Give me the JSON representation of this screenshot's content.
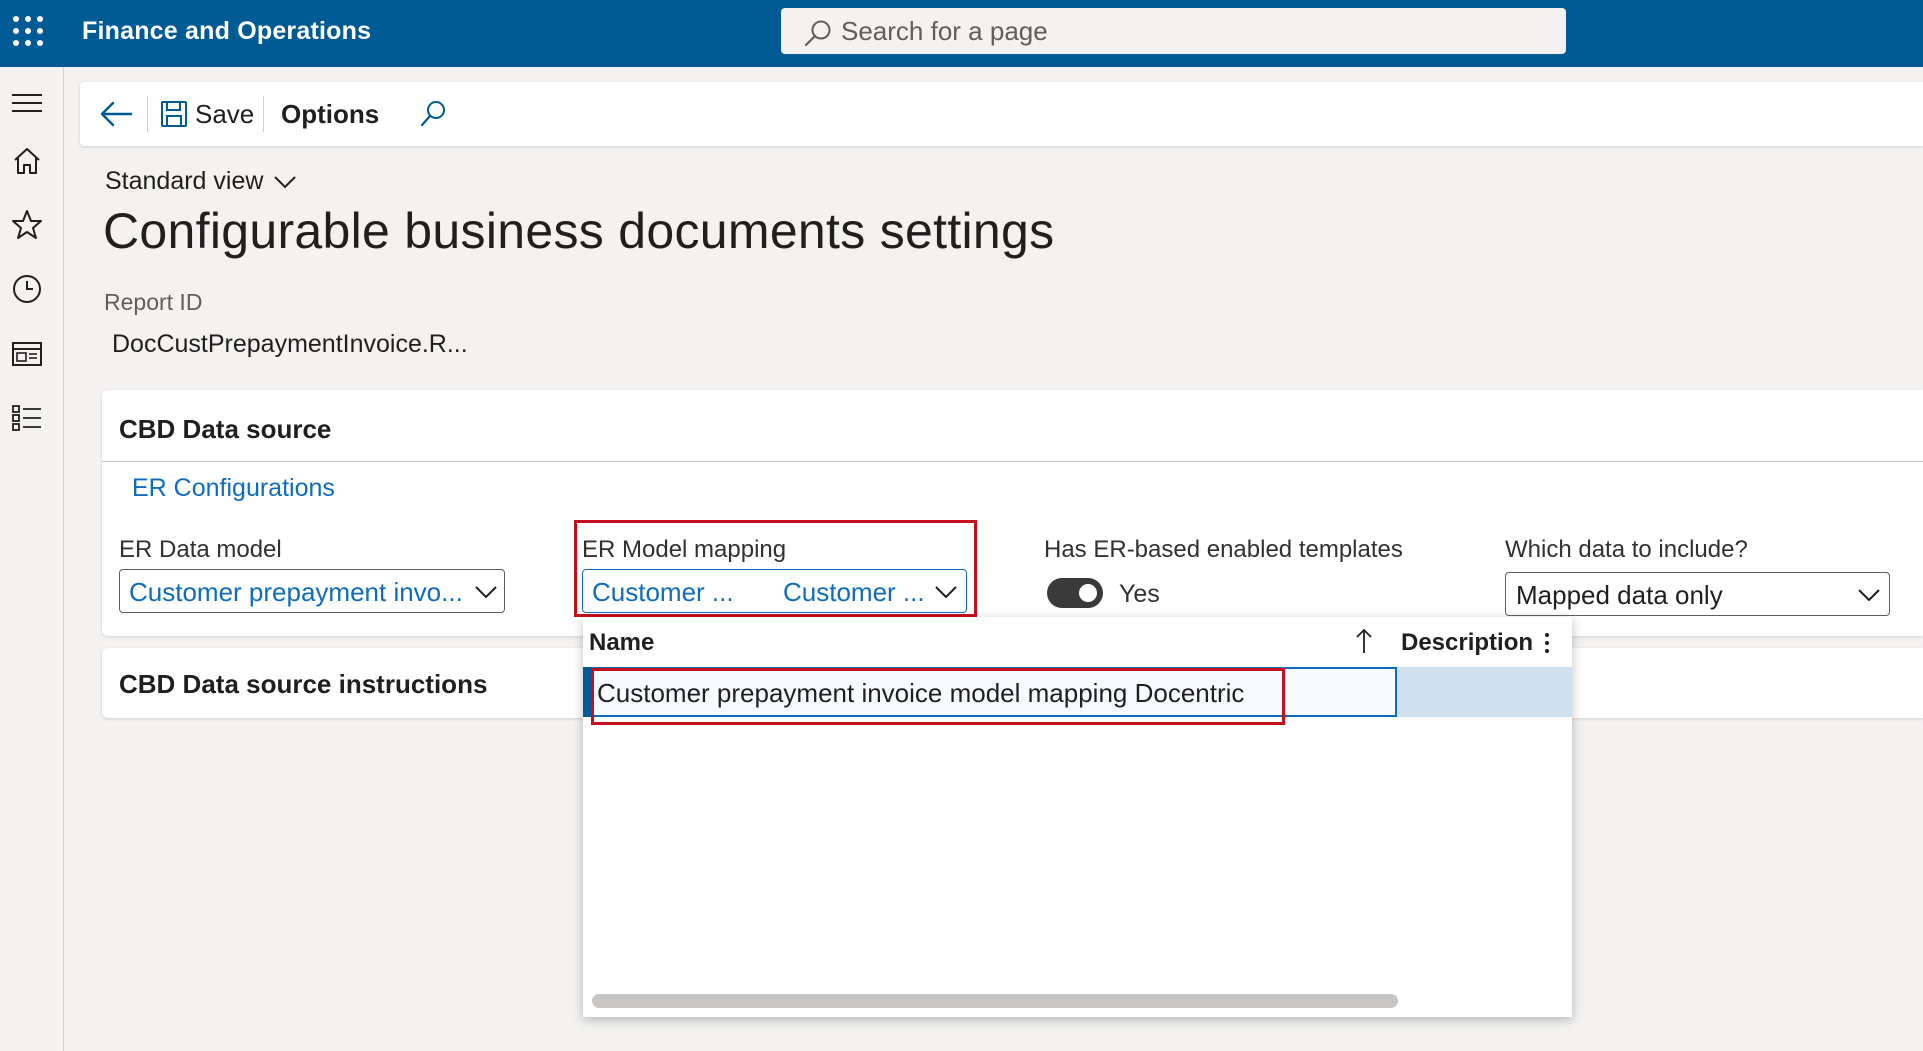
{
  "topbar": {
    "app_title": "Finance and Operations",
    "search_placeholder": "Search for a page"
  },
  "left_nav": {
    "items": [
      {
        "icon": "hamburger-icon"
      },
      {
        "icon": "home-icon"
      },
      {
        "icon": "star-icon"
      },
      {
        "icon": "clock-icon"
      },
      {
        "icon": "workspace-icon"
      },
      {
        "icon": "list-icon"
      }
    ]
  },
  "action_pane": {
    "save_label": "Save",
    "options_label": "Options"
  },
  "header": {
    "view_label": "Standard view",
    "title": "Configurable business documents settings",
    "report_id_label": "Report ID",
    "report_id_value": "DocCustPrepaymentInvoice.R..."
  },
  "data_source_tab": {
    "title": "CBD Data source",
    "er_link": "ER Configurations",
    "er_data_model_label": "ER Data model",
    "er_data_model_value": "Customer prepayment invo...",
    "er_model_mapping_label": "ER Model mapping",
    "er_model_mapping_value_1": "Customer ...",
    "er_model_mapping_value_2": "Customer ...",
    "templates_label": "Has ER-based enabled templates",
    "templates_value": "Yes",
    "include_label": "Which data to include?",
    "include_value": "Mapped data only"
  },
  "instructions_tab": {
    "title": "CBD Data source instructions"
  },
  "lookup": {
    "col_name": "Name",
    "col_description": "Description",
    "rows": [
      {
        "name": "Customer prepayment invoice model mapping Docentric",
        "description": ""
      }
    ]
  },
  "colors": {
    "topbar": "#005a93",
    "link": "#0f6cbd",
    "highlight": "#c50f1f",
    "selected_row": "#cfe0ee"
  }
}
